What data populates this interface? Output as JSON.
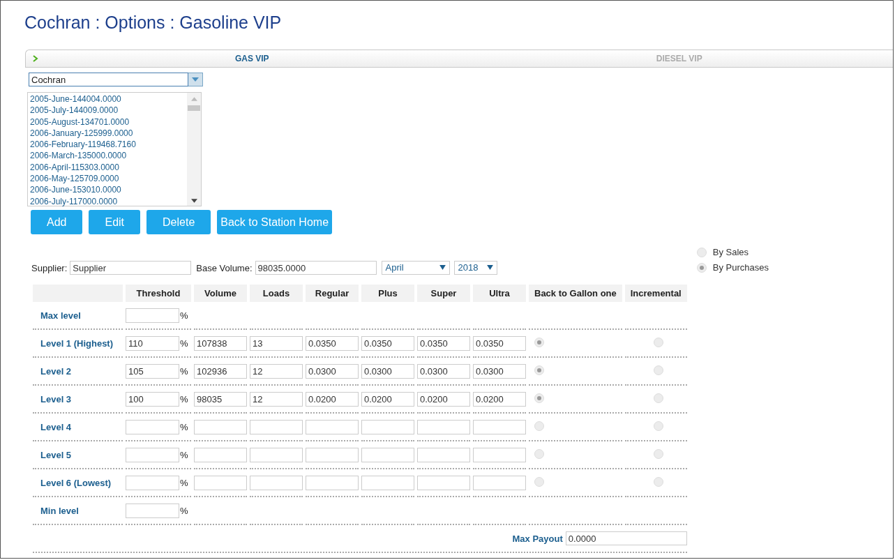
{
  "page_title": "Cochran : Options : Gasoline VIP",
  "tabs": [
    {
      "label": "GAS VIP",
      "selected": true
    },
    {
      "label": "DIESEL VIP",
      "selected": false
    }
  ],
  "station_select": {
    "value": "Cochran"
  },
  "history_list": [
    "2005-June-144004.0000",
    "2005-July-144009.0000",
    "2005-August-134701.0000",
    "2006-January-125999.0000",
    "2006-February-119468.7160",
    "2006-March-135000.0000",
    "2006-April-115303.0000",
    "2006-May-125709.0000",
    "2006-June-153010.0000",
    "2006-July-117000.0000"
  ],
  "buttons": [
    "Add",
    "Edit",
    "Delete",
    "Back to Station Home"
  ],
  "supplier": {
    "label": "Supplier:",
    "value": "Supplier"
  },
  "base_volume": {
    "label": "Base Volume:",
    "value": "98035.0000"
  },
  "month_select": {
    "value": "April"
  },
  "year_select": {
    "value": "2018"
  },
  "basis_options": [
    {
      "label": "By Sales",
      "selected": false
    },
    {
      "label": "By Purchases",
      "selected": true
    }
  ],
  "table": {
    "columns": [
      "Threshold",
      "Volume",
      "Loads",
      "Regular",
      "Plus",
      "Super",
      "Ultra",
      "Back to Gallon one",
      "Incremental"
    ],
    "percent_sign": "%",
    "rows": [
      {
        "kind": "bound",
        "label": "Max level",
        "threshold": ""
      },
      {
        "kind": "level",
        "label": "Level 1 (Highest)",
        "threshold": "110",
        "volume": "107838",
        "loads": "13",
        "regular": "0.0350",
        "plus": "0.0350",
        "super": "0.0350",
        "ultra": "0.0350",
        "back_to_gallon_one": true,
        "incremental": false
      },
      {
        "kind": "level",
        "label": "Level 2",
        "threshold": "105",
        "volume": "102936",
        "loads": "12",
        "regular": "0.0300",
        "plus": "0.0300",
        "super": "0.0300",
        "ultra": "0.0300",
        "back_to_gallon_one": true,
        "incremental": false
      },
      {
        "kind": "level",
        "label": "Level 3",
        "threshold": "100",
        "volume": "98035",
        "loads": "12",
        "regular": "0.0200",
        "plus": "0.0200",
        "super": "0.0200",
        "ultra": "0.0200",
        "back_to_gallon_one": true,
        "incremental": false
      },
      {
        "kind": "level",
        "label": "Level 4",
        "threshold": "",
        "volume": "",
        "loads": "",
        "regular": "",
        "plus": "",
        "super": "",
        "ultra": "",
        "back_to_gallon_one": false,
        "incremental": false
      },
      {
        "kind": "level",
        "label": "Level 5",
        "threshold": "",
        "volume": "",
        "loads": "",
        "regular": "",
        "plus": "",
        "super": "",
        "ultra": "",
        "back_to_gallon_one": false,
        "incremental": false
      },
      {
        "kind": "level",
        "label": "Level 6 (Lowest)",
        "threshold": "",
        "volume": "",
        "loads": "",
        "regular": "",
        "plus": "",
        "super": "",
        "ultra": "",
        "back_to_gallon_one": false,
        "incremental": false
      },
      {
        "kind": "bound",
        "label": "Min level",
        "threshold": ""
      }
    ]
  },
  "max_payout": {
    "label": "Max Payout",
    "value": "0.0000"
  }
}
